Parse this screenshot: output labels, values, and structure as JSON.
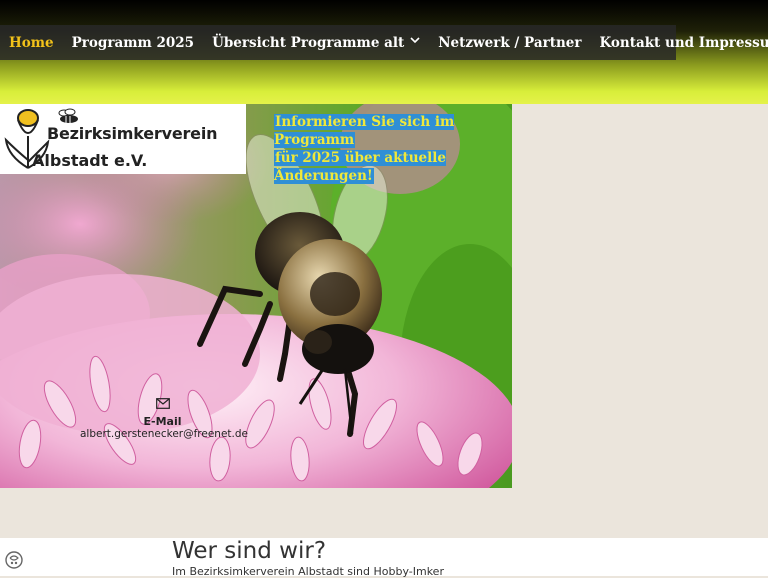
{
  "nav": {
    "items": [
      {
        "label": "Home",
        "active": true
      },
      {
        "label": "Programm 2025"
      },
      {
        "label": "Übersicht Programme alt",
        "dropdown": true
      },
      {
        "label": "Netzwerk / Partner"
      },
      {
        "label": "Kontakt und Impressum",
        "dropdown": true
      }
    ]
  },
  "logo": {
    "line1": "Bezirksimkerverein",
    "line2": "Albstadt e.V."
  },
  "banner": {
    "line1": "Informieren Sie sich im Programm",
    "line2": "für 2025 über aktuelle Änderungen!"
  },
  "contact": {
    "icon": "envelope-icon",
    "label": "E-Mail",
    "email": "albert.gerstenecker@freenet.de"
  },
  "content": {
    "heading": "Wer sind wir?",
    "intro": "Im Bezirksimkerverein Albstadt sind Hobby-Imker"
  },
  "colors": {
    "active_nav": "#f2c21a",
    "banner_bg": "#2f8fd6",
    "banner_text": "#f0e83a",
    "page_bg": "#ebe5dc"
  }
}
